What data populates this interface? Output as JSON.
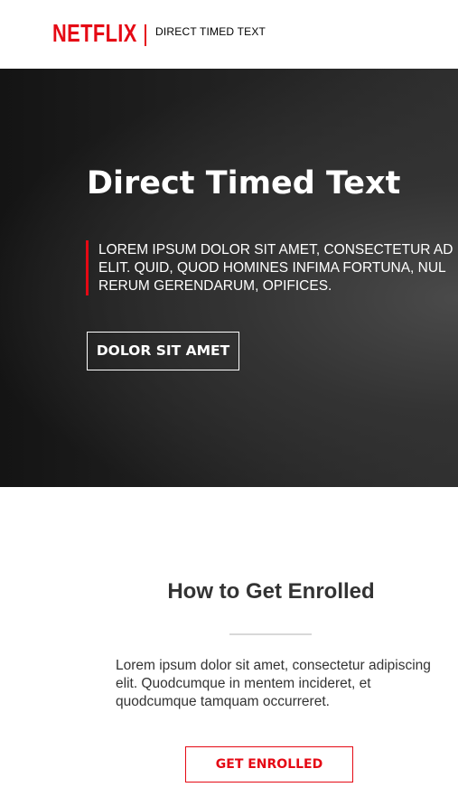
{
  "header": {
    "logo_text": "NETFLIX",
    "product_name": "DIRECT TIMED TEXT"
  },
  "hero": {
    "title": "Direct Timed Text",
    "description": "LOREM IPSUM DOLOR SIT AMET, CONSECTETUR AD\nELIT. QUID, QUOD HOMINES INFIMA FORTUNA, NUL\nRERUM GERENDARUM, OPIFICES.",
    "button_label": "DOLOR SIT AMET"
  },
  "enroll": {
    "title": "How to Get Enrolled",
    "description": "Lorem ipsum dolor sit amet, consectetur adipiscing\nelit. Quodcumque in mentem incideret, et\nquodcumque tamquam occurreret.",
    "button_label": "GET ENROLLED"
  },
  "colors": {
    "brand_red": "#e50914",
    "hero_background": "#1f1f1f",
    "body_text": "#333333"
  }
}
